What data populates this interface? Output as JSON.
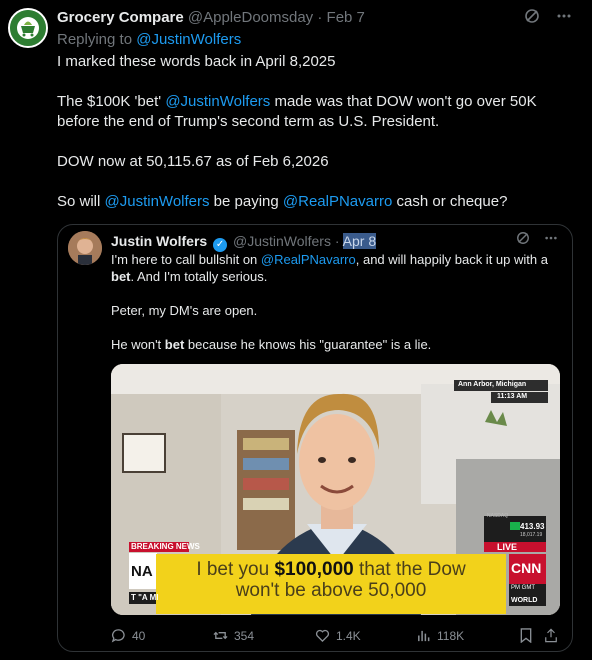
{
  "tweet": {
    "avatar_text": "GROCERY COMPARE",
    "display_name": "Grocery Compare",
    "handle": "@AppleDoomsday",
    "separator": " · ",
    "date": "Feb 7",
    "replying_prefix": "Replying to ",
    "replying_handle": "@JustinWolfers",
    "para1": "I marked these words back in April 8,2025",
    "para2_a": "The $100K 'bet' ",
    "para2_mention": "@JustinWolfers",
    "para2_b": " made was that DOW won't go over 50K before the end of Trump's second term as U.S. President.",
    "para3": "DOW now at 50,115.67 as of Feb 6,2026",
    "para4_a": "So will ",
    "para4_mention1": "@JustinWolfers",
    "para4_b": " be paying ",
    "para4_mention2": "@RealPNavarro",
    "para4_c": " cash or cheque?"
  },
  "quote": {
    "display_name": "Justin Wolfers",
    "handle": "@JustinWolfers",
    "separator": " · ",
    "date": "Apr 8",
    "line1_a": "I'm here to call bullshit on ",
    "line1_mention": "@RealPNavarro",
    "line1_b": ", and will happily back it up with a ",
    "line1_bold": "bet",
    "line1_c": ". And I'm totally serious.",
    "line2": "Peter, my DM's are open.",
    "line3_a": "He won't ",
    "line3_bold": "bet",
    "line3_b": " because he knows his \"guarantee\" is a lie.",
    "video": {
      "location": "Ann Arbor, Michigan",
      "time": "11:13 AM",
      "breaking": "BREAKING NEWS",
      "lower_left": "NA",
      "lower_left2": "T \"A MI",
      "caption_a": "I bet you ",
      "caption_bold": "$100,000",
      "caption_b": " that the Dow",
      "caption_line2": "won't be above 50,000",
      "ticker_label": "NASDAQ",
      "ticker_value": "413.93",
      "ticker_sub": "18,017.19",
      "live": "LIVE",
      "network": "CNN",
      "pm": "PM GMT",
      "world": "WORLD"
    },
    "actions": {
      "replies": "40",
      "reposts": "354",
      "likes": "1.4K",
      "views": "118K"
    }
  },
  "colors": {
    "background": "#000000",
    "text": "#e7e9ea",
    "muted": "#71767b",
    "link": "#1d9bf0",
    "caption_bg": "#f2d21b",
    "breaking_red": "#c8102e"
  },
  "icons": [
    "grok-icon",
    "more-icon",
    "verified-icon",
    "reply-icon",
    "repost-icon",
    "like-icon",
    "views-icon",
    "bookmark-icon",
    "share-icon"
  ]
}
